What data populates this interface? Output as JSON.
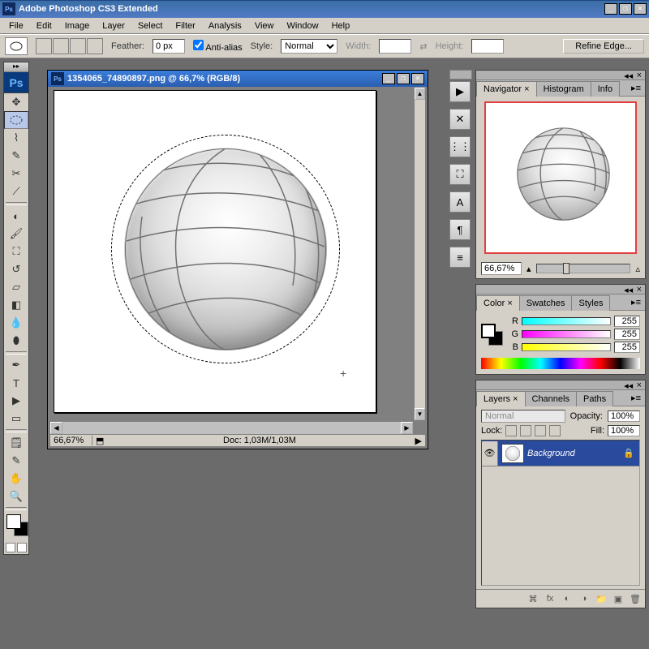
{
  "app": {
    "title": "Adobe Photoshop CS3 Extended"
  },
  "menu": [
    "File",
    "Edit",
    "Image",
    "Layer",
    "Select",
    "Filter",
    "Analysis",
    "View",
    "Window",
    "Help"
  ],
  "options": {
    "feather_label": "Feather:",
    "feather_value": "0 px",
    "antialias_label": "Anti-alias",
    "style_label": "Style:",
    "style_value": "Normal",
    "width_label": "Width:",
    "height_label": "Height:",
    "refine_label": "Refine Edge..."
  },
  "doc": {
    "title": "1354065_74890897.png @ 66,7% (RGB/8)",
    "zoom": "66,67%",
    "info": "Doc: 1,03M/1,03M"
  },
  "navigator": {
    "tabs": [
      "Navigator ×",
      "Histogram",
      "Info"
    ],
    "zoom": "66,67%"
  },
  "color": {
    "tabs": [
      "Color ×",
      "Swatches",
      "Styles"
    ],
    "channels": [
      {
        "label": "R",
        "value": "255"
      },
      {
        "label": "G",
        "value": "255"
      },
      {
        "label": "B",
        "value": "255"
      }
    ]
  },
  "layers": {
    "tabs": [
      "Layers ×",
      "Channels",
      "Paths"
    ],
    "blend": "Normal",
    "opacity_label": "Opacity:",
    "opacity": "100%",
    "lock_label": "Lock:",
    "fill_label": "Fill:",
    "fill": "100%",
    "bg_name": "Background"
  }
}
